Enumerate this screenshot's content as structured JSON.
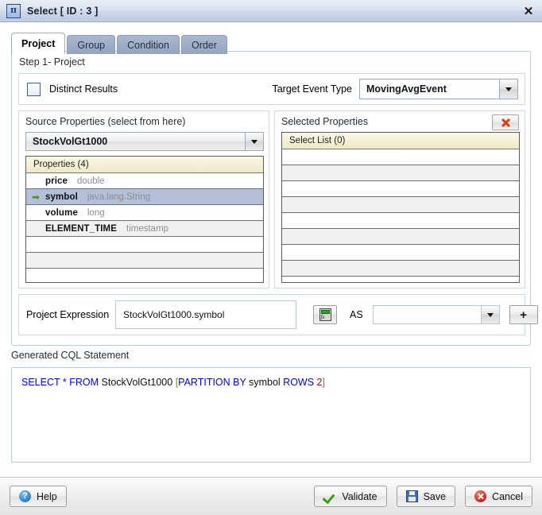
{
  "window": {
    "title": "Select [ ID : 3 ]",
    "icon": "pi-icon",
    "icon_glyph": "π",
    "close_label": "✕"
  },
  "tabs": [
    {
      "label": "Project",
      "active": true
    },
    {
      "label": "Group",
      "active": false
    },
    {
      "label": "Condition",
      "active": false
    },
    {
      "label": "Order",
      "active": false
    }
  ],
  "step": {
    "label": "Step 1- Project"
  },
  "options": {
    "distinct_label": "Distinct Results",
    "distinct_checked": false,
    "target_event_type_label": "Target Event Type",
    "target_event_type_value": "MovingAvgEvent"
  },
  "source_panel": {
    "title": "Source Properties (select from here)",
    "stream_value": "StockVolGt1000",
    "grid_header": "Properties (4)",
    "rows": [
      {
        "name": "price",
        "type": "double",
        "selected": false
      },
      {
        "name": "symbol",
        "type": "java.lang.String",
        "selected": true
      },
      {
        "name": "volume",
        "type": "long",
        "selected": false
      },
      {
        "name": "ELEMENT_TIME",
        "type": "timestamp",
        "selected": false
      },
      {
        "name": "",
        "type": "",
        "selected": false
      },
      {
        "name": "",
        "type": "",
        "selected": false
      },
      {
        "name": "",
        "type": "",
        "selected": false
      }
    ],
    "selected_arrow_glyph": "➡"
  },
  "selected_panel": {
    "title": "Selected Properties",
    "delete_icon": "red-x-icon",
    "grid_header": "Select List (0)",
    "rows": [
      "",
      "",
      "",
      "",
      "",
      "",
      "",
      ""
    ]
  },
  "expression": {
    "label": "Project Expression",
    "value": "StockVolGt1000.symbol",
    "fx_icon": "calculator-fx-icon",
    "as_label": "AS",
    "as_value": "",
    "add_label": "+"
  },
  "cql": {
    "label": "Generated CQL Statement",
    "tokens": [
      {
        "text": "SELECT",
        "kind": "kw"
      },
      {
        "text": " ",
        "kind": "id"
      },
      {
        "text": "*",
        "kind": "kw"
      },
      {
        "text": " ",
        "kind": "id"
      },
      {
        "text": "FROM",
        "kind": "kw"
      },
      {
        "text": " ",
        "kind": "id"
      },
      {
        "text": "StockVolGt1000",
        "kind": "id"
      },
      {
        "text": "  ",
        "kind": "id"
      },
      {
        "text": "[",
        "kind": "br"
      },
      {
        "text": "PARTITION BY",
        "kind": "kw"
      },
      {
        "text": " ",
        "kind": "id"
      },
      {
        "text": "symbol",
        "kind": "id"
      },
      {
        "text": "  ",
        "kind": "id"
      },
      {
        "text": "ROWS",
        "kind": "kw"
      },
      {
        "text": " ",
        "kind": "id"
      },
      {
        "text": "2",
        "kind": "num"
      },
      {
        "text": "]",
        "kind": "br"
      }
    ],
    "plain": "SELECT * FROM StockVolGt1000  [PARTITION BY symbol  ROWS 2]"
  },
  "footer": {
    "help_label": "Help",
    "validate_label": "Validate",
    "save_label": "Save",
    "cancel_label": "Cancel"
  },
  "colors": {
    "keyword": "#0000ee",
    "bracket": "#7f7f1e",
    "number": "#9c1212",
    "selection": "#b4c0d8",
    "grid_header": "#efe9c8",
    "tab_inactive": "#93a4c0"
  }
}
